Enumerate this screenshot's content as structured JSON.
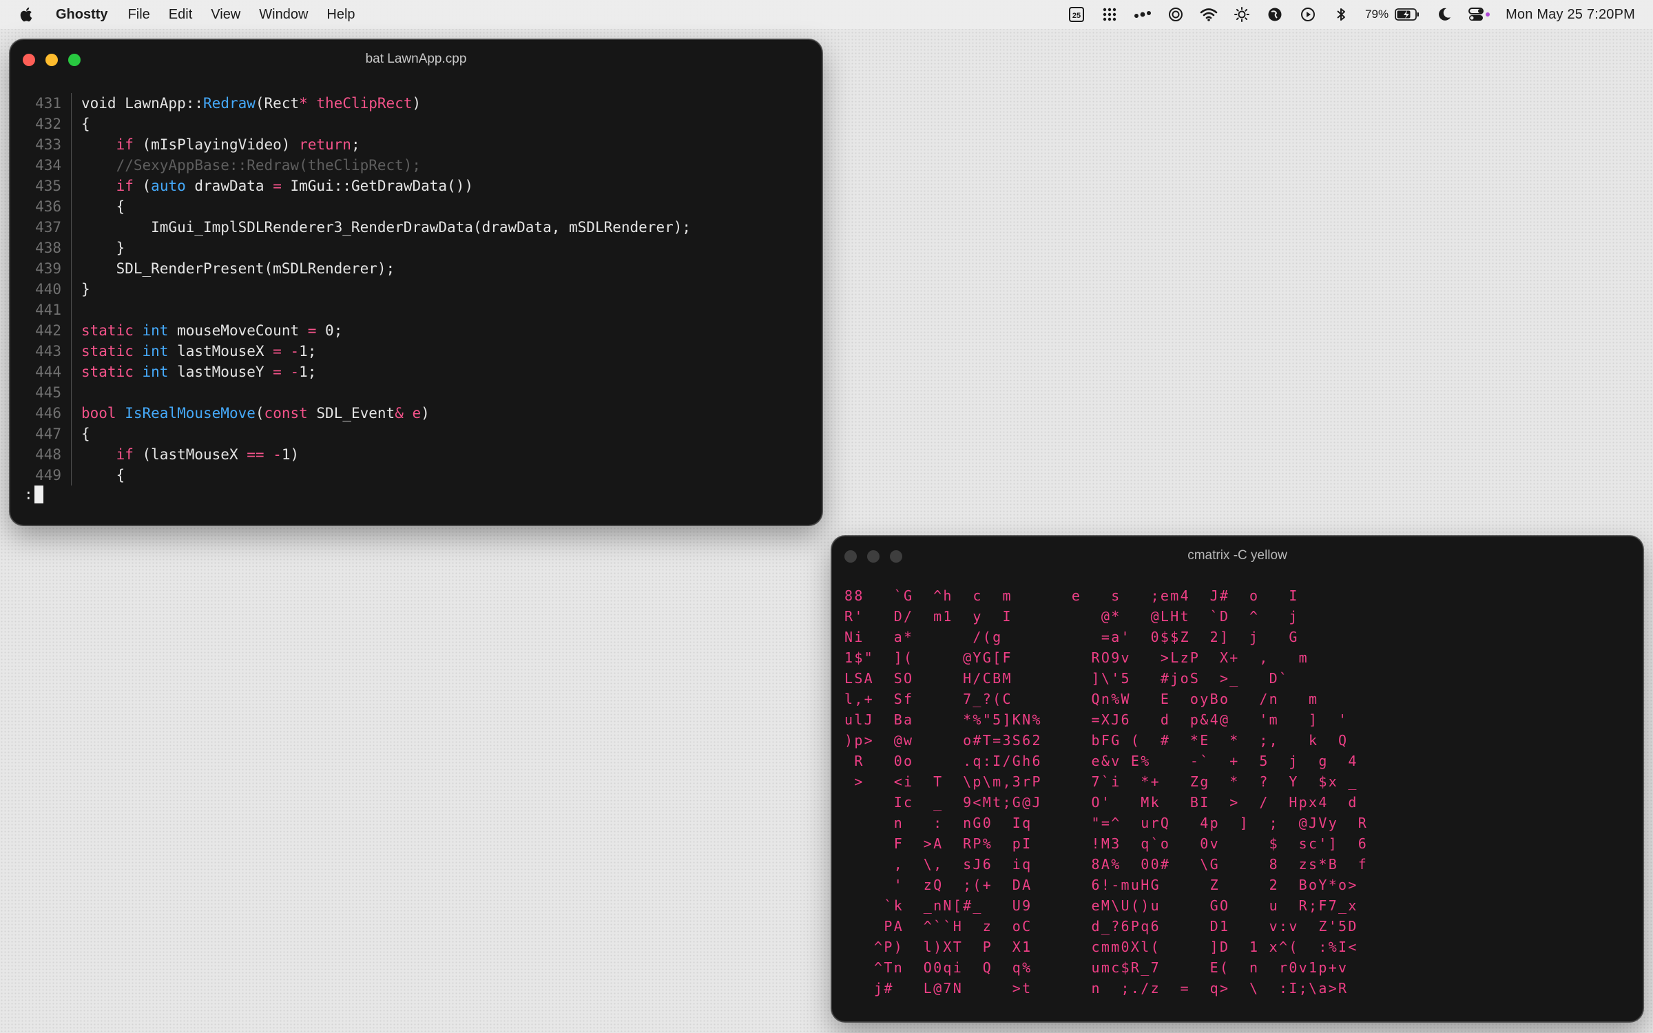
{
  "menubar": {
    "app_name": "Ghostty",
    "menus": [
      "File",
      "Edit",
      "View",
      "Window",
      "Help"
    ],
    "calendar_day": "25",
    "battery_percent": "79%",
    "clock": "Mon May 25  7:20PM",
    "status_icons": [
      "calendar-icon",
      "grid-icon",
      "dots-icon",
      "focus-icon",
      "wifi-icon",
      "brightness-icon",
      "vpn-icon",
      "play-icon",
      "bluetooth-icon",
      "battery-icon",
      "moon-icon",
      "control-center-icon"
    ]
  },
  "bat_window": {
    "title": "bat LawnApp.cpp",
    "prompt": ":",
    "lines": [
      {
        "n": "431",
        "segs": [
          {
            "t": "void",
            "c": "src"
          },
          {
            "t": " LawnApp",
            "c": "src"
          },
          {
            "t": "::",
            "c": "src"
          },
          {
            "t": "Redraw",
            "c": "ty"
          },
          {
            "t": "(Rect",
            "c": "src"
          },
          {
            "t": "*",
            "c": "kw"
          },
          {
            "t": " theClipRect",
            "c": "kw"
          },
          {
            "t": ")",
            "c": "src"
          }
        ]
      },
      {
        "n": "432",
        "segs": [
          {
            "t": "{",
            "c": "src"
          }
        ]
      },
      {
        "n": "433",
        "segs": [
          {
            "t": "    ",
            "c": "src"
          },
          {
            "t": "if",
            "c": "kw"
          },
          {
            "t": " (mIsPlayingVideo) ",
            "c": "src"
          },
          {
            "t": "return",
            "c": "kw"
          },
          {
            "t": ";",
            "c": "src"
          }
        ]
      },
      {
        "n": "434",
        "segs": [
          {
            "t": "    //SexyAppBase::Redraw(theClipRect);",
            "c": "cm"
          }
        ]
      },
      {
        "n": "435",
        "segs": [
          {
            "t": "    ",
            "c": "src"
          },
          {
            "t": "if",
            "c": "kw"
          },
          {
            "t": " (",
            "c": "src"
          },
          {
            "t": "auto",
            "c": "ty"
          },
          {
            "t": " drawData ",
            "c": "src"
          },
          {
            "t": "=",
            "c": "kw"
          },
          {
            "t": " ImGui::GetDrawData())",
            "c": "src"
          }
        ]
      },
      {
        "n": "436",
        "segs": [
          {
            "t": "    {",
            "c": "src"
          }
        ]
      },
      {
        "n": "437",
        "segs": [
          {
            "t": "        ImGui_ImplSDLRenderer3_RenderDrawData(drawData, mSDLRenderer);",
            "c": "src"
          }
        ]
      },
      {
        "n": "438",
        "segs": [
          {
            "t": "    }",
            "c": "src"
          }
        ]
      },
      {
        "n": "439",
        "segs": [
          {
            "t": "    SDL_RenderPresent(mSDLRenderer);",
            "c": "src"
          }
        ]
      },
      {
        "n": "440",
        "segs": [
          {
            "t": "}",
            "c": "src"
          }
        ]
      },
      {
        "n": "441",
        "segs": []
      },
      {
        "n": "442",
        "segs": [
          {
            "t": "static",
            "c": "kw"
          },
          {
            "t": " ",
            "c": "src"
          },
          {
            "t": "int",
            "c": "ty"
          },
          {
            "t": " mouseMoveCount ",
            "c": "src"
          },
          {
            "t": "=",
            "c": "kw"
          },
          {
            "t": " 0;",
            "c": "src"
          }
        ]
      },
      {
        "n": "443",
        "segs": [
          {
            "t": "static",
            "c": "kw"
          },
          {
            "t": " ",
            "c": "src"
          },
          {
            "t": "int",
            "c": "ty"
          },
          {
            "t": " lastMouseX ",
            "c": "src"
          },
          {
            "t": "=",
            "c": "kw"
          },
          {
            "t": " ",
            "c": "src"
          },
          {
            "t": "-",
            "c": "kw"
          },
          {
            "t": "1;",
            "c": "src"
          }
        ]
      },
      {
        "n": "444",
        "segs": [
          {
            "t": "static",
            "c": "kw"
          },
          {
            "t": " ",
            "c": "src"
          },
          {
            "t": "int",
            "c": "ty"
          },
          {
            "t": " lastMouseY ",
            "c": "src"
          },
          {
            "t": "=",
            "c": "kw"
          },
          {
            "t": " ",
            "c": "src"
          },
          {
            "t": "-",
            "c": "kw"
          },
          {
            "t": "1;",
            "c": "src"
          }
        ]
      },
      {
        "n": "445",
        "segs": []
      },
      {
        "n": "446",
        "segs": [
          {
            "t": "bool",
            "c": "kw"
          },
          {
            "t": " ",
            "c": "src"
          },
          {
            "t": "IsRealMouseMove",
            "c": "ty"
          },
          {
            "t": "(",
            "c": "src"
          },
          {
            "t": "const",
            "c": "kw"
          },
          {
            "t": " SDL_Event",
            "c": "src"
          },
          {
            "t": "&",
            "c": "kw"
          },
          {
            "t": " e",
            "c": "kw"
          },
          {
            "t": ")",
            "c": "src"
          }
        ]
      },
      {
        "n": "447",
        "segs": [
          {
            "t": "{",
            "c": "src"
          }
        ]
      },
      {
        "n": "448",
        "segs": [
          {
            "t": "    ",
            "c": "src"
          },
          {
            "t": "if",
            "c": "kw"
          },
          {
            "t": " (lastMouseX ",
            "c": "src"
          },
          {
            "t": "==",
            "c": "kw"
          },
          {
            "t": " ",
            "c": "src"
          },
          {
            "t": "-",
            "c": "kw"
          },
          {
            "t": "1)",
            "c": "src"
          }
        ]
      },
      {
        "n": "449",
        "segs": [
          {
            "t": "    {",
            "c": "src"
          }
        ]
      }
    ]
  },
  "matrix_window": {
    "title": "cmatrix -C yellow",
    "rows": [
      "88   `G  ^h  c  m      e   s   ;em4  J#  o   I",
      "R'   D/  m1  y  I         @*   @LHt  `D  ^   j",
      "Ni   a*      /(g          =a'  0$$Z  2]  j   G",
      "1$\"  ](     @YG[F        RO9v   >LzP  X+  ,   m",
      "LSA  SO     H/CBM        ]\\'5   #joS  >_   D`",
      "l,+  Sf     7_?(C        Qn%W   E  oyBo   /n   m",
      "ulJ  Ba     *%\"5]KN%     =XJ6   d  p&4@   'm   ]  '",
      ")p>  @w     o#T=3S62     bFG (  #  *E  *  ;,   k  Q",
      " R   0o     .q:I/Gh6     e&v E%    -`  +  5  j  g  4",
      " >   <i  T  \\p\\m,3rP     7`i  *+   Zg  *  ?  Y  $x _",
      "     Ic  _  9<Mt;G@J     O'   Mk   BI  >  /  Hpx4  d",
      "     n   :  nG0  Iq      \"=^  urQ   4p  ]  ;  @JVy  R",
      "     F  >A  RP%  pI      !M3  q`o   0v     $  sc']  6",
      "     ,  \\,  sJ6  iq      8A%  00#   \\G     8  zs*B  f",
      "     '  zQ  ;(+  DA      6!-muHG     Z     2  BoY*o>",
      "    `k  _nN[#_   U9      eM\\U()u     GO    u  R;F7_x",
      "    PA  ^``H  z  oC      d_?6Pq6     D1    v:v  Z'5D",
      "   ^P)  l)XT  P  X1      cmm0Xl(     ]D  1 x^(  :%I<",
      "   ^Tn  O0qi  Q  q%      umc$R_7     E(  n  r0v1p+v",
      "   j#   L@7N     >t      n  ;./z  =  q>  \\  :I;\\a>R"
    ]
  }
}
